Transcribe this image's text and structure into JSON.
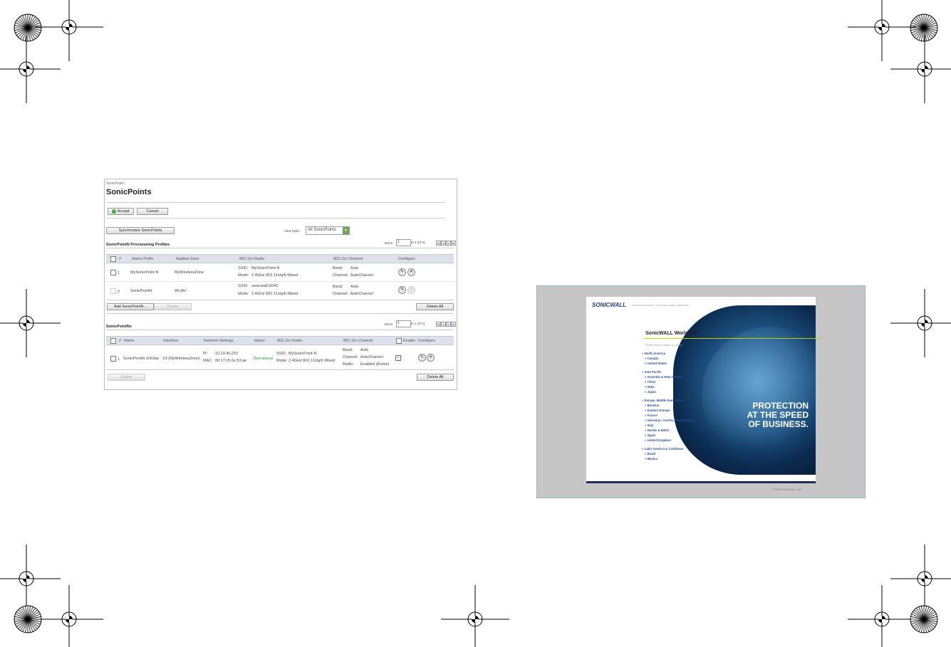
{
  "breadcrumb": "SonicPoint /",
  "page_title": "SonicPoints",
  "toolbar": {
    "accept": "Accept",
    "cancel": "Cancel"
  },
  "sync_button": "Synchronize SonicPoints",
  "view_style": {
    "label": "View Style:",
    "value": "All SonicPoints"
  },
  "profiles": {
    "title": "SonicPointN Provisioning Profiles",
    "pager": {
      "label": "Items",
      "value": "1",
      "range": "to 2 (of 2)"
    },
    "headers": [
      "#",
      "Name Prefix",
      "Applied Zone",
      "802.11n Radio",
      "802.11n Channel",
      "Configure"
    ],
    "rows": [
      {
        "num": "1",
        "name": "MySonicPoint-N",
        "zone": "MyWirelessZone",
        "ssid_label": "SSID:",
        "ssid": "MySonicPoint-N",
        "mode_label": "Mode:",
        "mode": "2.4GHz 802.11n/g/b Mixed",
        "band_label": "Band:",
        "band": "Auto",
        "channel_label": "Channel:",
        "channel": "AutoChannel"
      },
      {
        "num": "2",
        "name": "SonicPointN",
        "zone": "WLAN",
        "ssid_label": "SSID:",
        "ssid": "sonicwall-6D4C",
        "mode_label": "Mode:",
        "mode": "2.4GHz 802.11n/g/b Mixed",
        "band_label": "Band:",
        "band": "Auto",
        "channel_label": "Channel:",
        "channel": "AutoChannel"
      }
    ],
    "add_button": "Add SonicPointN...",
    "delete_button": "Delete",
    "delete_all_button": "Delete All"
  },
  "sonicpoints": {
    "title": "SonicPointNs",
    "pager": {
      "label": "Items",
      "value": "1",
      "range": "to 1 (of 1)"
    },
    "headers": [
      "#",
      "Name",
      "Interface",
      "Network Settings",
      "Status",
      "802.11n Radio",
      "802.11n Channel",
      "Enable",
      "Configure"
    ],
    "row": {
      "num": "1",
      "name": "SonicPointN 2e53ae",
      "interface": "X3 (MyWirelessZone)",
      "ip_label": "IP:",
      "ip": "10.10.40.253",
      "mac_label": "MAC:",
      "mac": "00:17:c5:2e:53:ae",
      "status": "Operational",
      "ssid_label": "SSID:",
      "ssid": "MySonicPoint-N",
      "mode_label": "Mode:",
      "mode": "2.4GHz 802.11n/g/b Mixed",
      "band_label": "Band:",
      "band": "Auto",
      "channel_label": "Channel:",
      "channel": "AutoChannel",
      "radio_label": "Radio:",
      "radio": "Enabled (Active)"
    },
    "delete_button": "Delete",
    "delete_all_button": "Delete All"
  },
  "website": {
    "logo": "SONICWALL",
    "tagline": "DYNAMIC SECURITY FOR THE GLOBAL NETWORK",
    "heading": "SonicWALL Worldwide",
    "prompt": "Please select a region or country",
    "regions": [
      {
        "name": "North America",
        "countries": [
          "Canada",
          "United States"
        ]
      },
      {
        "name": "Asia Pacific",
        "countries": [
          "Australia & New Zealand",
          "China",
          "India",
          "Japan"
        ]
      },
      {
        "name": "Europe, Middle East, Africa",
        "countries": [
          "Benelux",
          "Eastern Europe",
          "France",
          "Germany / Austria / Switzerland",
          "Italy",
          "Nordic & Baltic",
          "Spain",
          "United Kingdom"
        ]
      },
      {
        "name": "Latin America & Caribbean",
        "countries": [
          "Brazil",
          "Mexico"
        ]
      }
    ],
    "slogan": [
      "PROTECTION",
      "AT THE SPEED",
      "OF BUSINESS."
    ],
    "copyright": "© 2010 SONICWALL, INC."
  }
}
